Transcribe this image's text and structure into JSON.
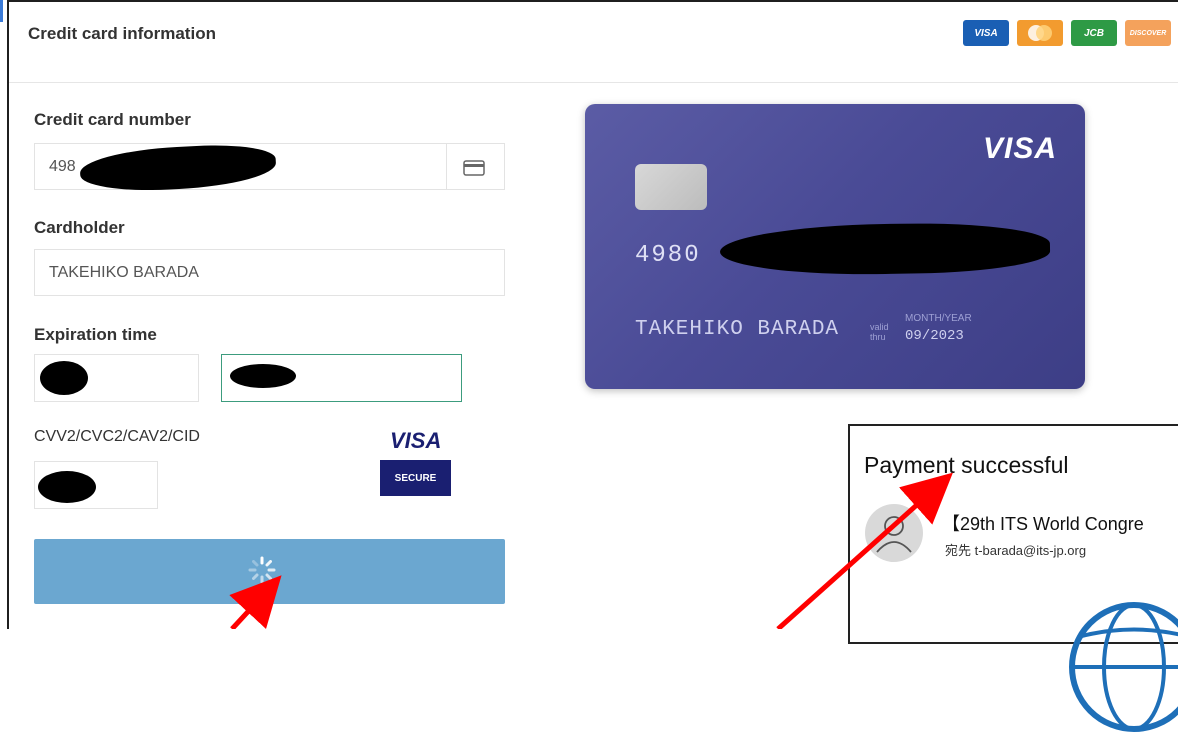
{
  "header": {
    "title": "Credit card information",
    "logos": [
      "VISA",
      "JCB",
      "DISCOVER"
    ]
  },
  "form": {
    "card_number_label": "Credit card number",
    "card_number_value": "498",
    "cardholder_label": "Cardholder",
    "cardholder_value": "TAKEHIKO BARADA",
    "expiration_label": "Expiration time",
    "cvv_label": "CVV2/CVC2/CAV2/CID",
    "visa_secure_brand": "VISA",
    "visa_secure_text": "SECURE"
  },
  "card_preview": {
    "brand": "VISA",
    "number_visible": "4980",
    "holder": "TAKEHIKO BARADA",
    "valid_line1": "valid",
    "valid_line2": "thru",
    "month_year_label": "MONTH/YEAR",
    "expiry": "09/2023"
  },
  "popup": {
    "title": "Payment successful",
    "subject": "【29th ITS World Congre",
    "to": "宛先 t-barada@its-jp.org"
  },
  "colors": {
    "card_bg": "#4a4b96",
    "submit_bg": "#6ba7d0",
    "annotation_arrow": "#ff0000",
    "visa_blue": "#1a1f71"
  }
}
